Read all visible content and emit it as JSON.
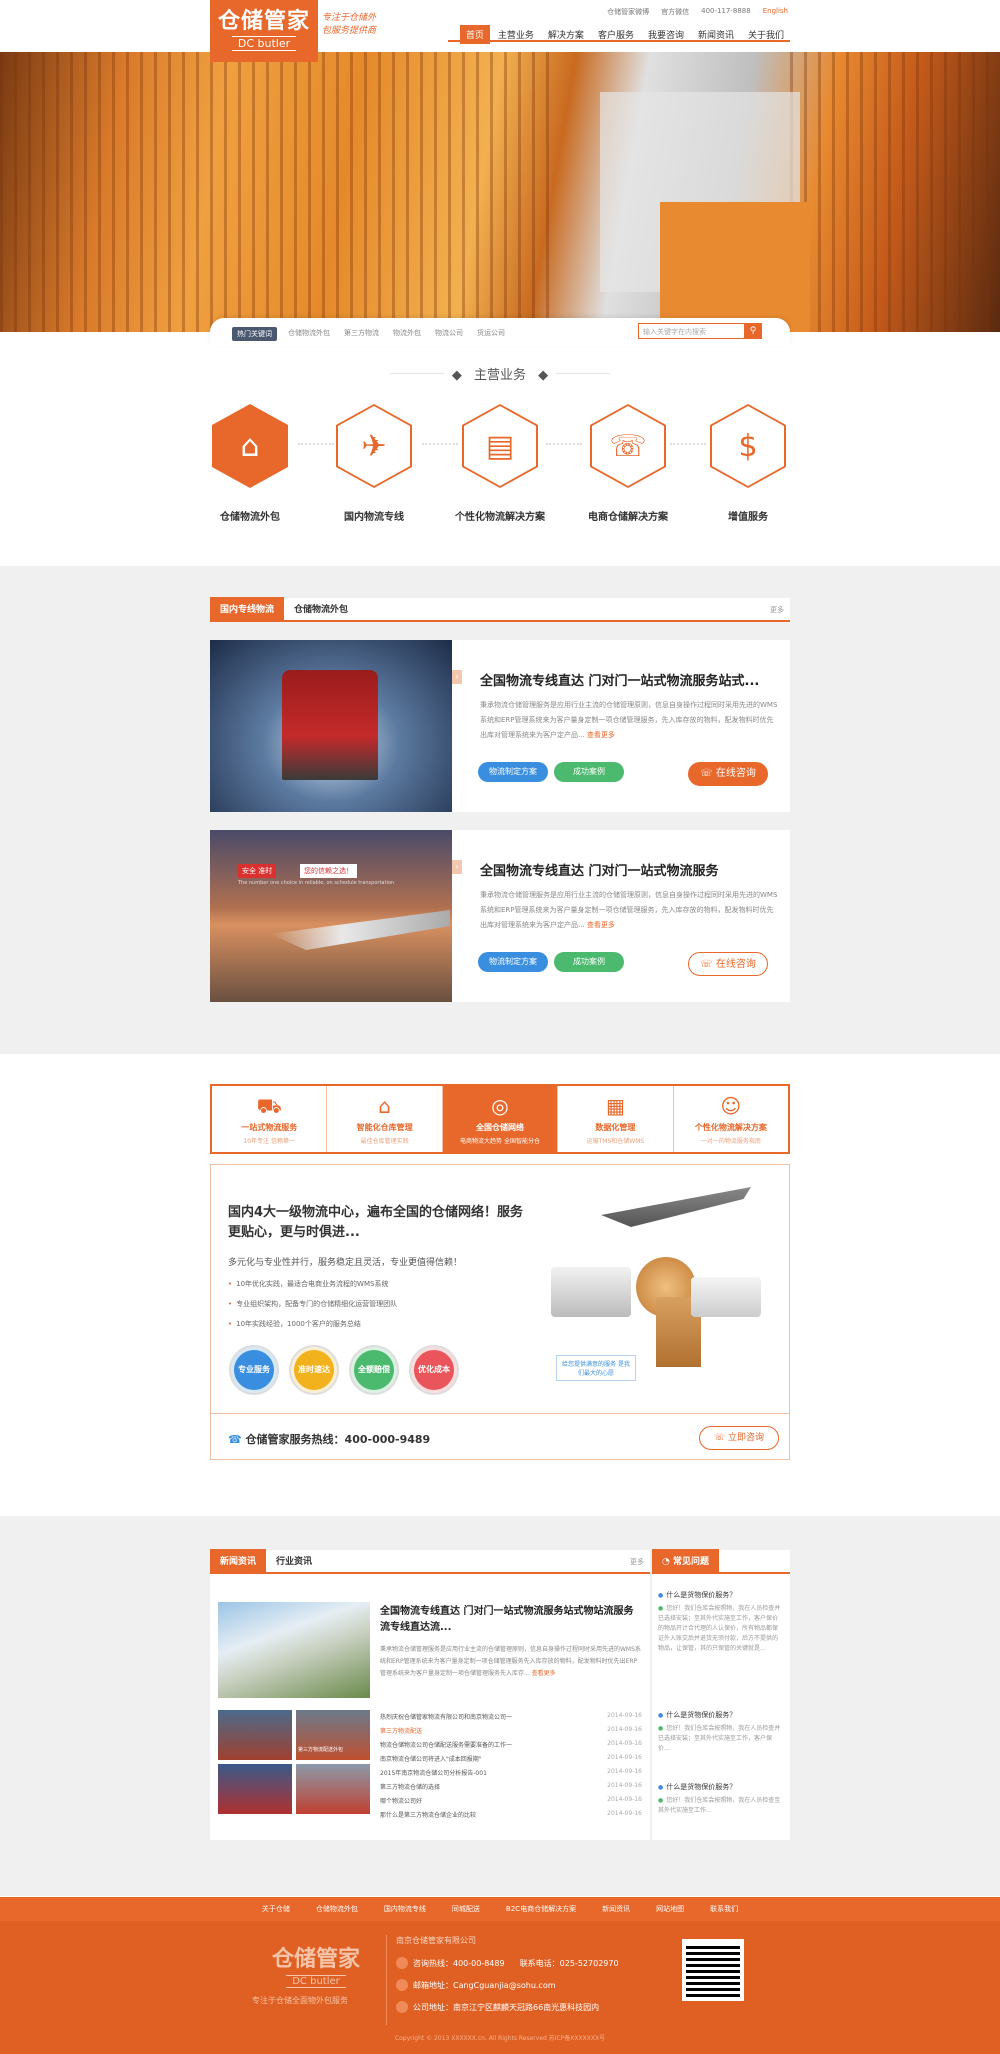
{
  "brand": {
    "name": "仓储管家",
    "sub": "DC butler",
    "slogan_lines": [
      "专注于仓储外",
      "包服务提供商"
    ]
  },
  "toplinks": {
    "weibo": "仓储管家微博",
    "wechat": "官方微信",
    "phone": "400-117-8888",
    "english": "English"
  },
  "nav": [
    "首页",
    "主营业务",
    "解决方案",
    "客户服务",
    "我要咨询",
    "新闻资讯",
    "关于我们"
  ],
  "hot": {
    "label": "热门关键词",
    "words": [
      "仓储物流外包",
      "第三方物流",
      "物流外包",
      "物流公司",
      "货运公司"
    ],
    "search_placeholder": "输入关键字在内搜索"
  },
  "main_business": {
    "title": "主营业务",
    "items": [
      {
        "label": "仓储物流外包",
        "icon": "warehouse-icon"
      },
      {
        "label": "国内物流专线",
        "icon": "globe-plane-icon"
      },
      {
        "label": "个性化物流解决方案",
        "icon": "box-list-icon"
      },
      {
        "label": "电商仓储解决方案",
        "icon": "24h-phone-icon"
      },
      {
        "label": "增值服务",
        "icon": "money-hand-icon"
      }
    ]
  },
  "logistics": {
    "tabs": [
      "国内专线物流",
      "仓储物流外包"
    ],
    "more": "更多",
    "cards": [
      {
        "title": "全国物流专线直达 门对门一站式物流服务站式...",
        "desc": "秉承物流仓储管理服务是应用行业主流的仓储管理原则，信息自身操作过程同时采用先进的WMS系统和ERP管理系统来为客户量身定制一项仓储管理服务，先入库存放的物料，配发物料时优先出库对管理系统来为客户定产品...",
        "more": "查看更多",
        "btn1": "物流制定方案",
        "btn2": "成功案例",
        "consult": "在线咨询"
      },
      {
        "title": "全国物流专线直达 门对门一站式物流服务",
        "desc": "秉承物流仓储管理服务是应用行业主流的仓储管理原则，信息自身操作过程同时采用先进的WMS系统和ERP管理系统来为客户量身定制一项仓储管理服务，先入库存放的物料，配发物料时优先出库对管理系统来为客户定产品...",
        "more": "查看更多",
        "btn1": "物流制定方案",
        "btn2": "成功案例",
        "consult": "在线咨询",
        "img_badge1": "安全 准时",
        "img_badge2": "您的信赖之选！",
        "img_caption": "The number one choice in reliable, on schedule transportation"
      }
    ]
  },
  "features": {
    "tabs": [
      {
        "t1": "一站式物流服务",
        "t2": "10年专注 信赖第一",
        "icon": "truck-icon"
      },
      {
        "t1": "智能化仓库管理",
        "t2": "最佳仓库管理实践",
        "icon": "warehouse-icon"
      },
      {
        "t1": "全国仓储网络",
        "t2": "电商物流大趋势 全国智能分仓",
        "icon": "globe-icon"
      },
      {
        "t1": "数据化管理",
        "t2": "运输TMS和仓储WMS",
        "icon": "clipboard-icon"
      },
      {
        "t1": "个性化物流解决方案",
        "t2": "一对一的物流服务指南",
        "icon": "support-icon"
      }
    ],
    "heading": "国内4大一级物流中心，遍布全国的仓储网络！服务更贴心，更与时俱进...",
    "sub": "多元化与专业性并行，服务稳定且灵活，专业更值得信赖！",
    "bullets": [
      "10年优化实践，最适合电商业务流程的WMS系统",
      "专业组织架构，配备专门的仓储精细化运营管理团队",
      "10年实践经验，1000个客户的服务总结"
    ],
    "circles": [
      {
        "label": "专业服务",
        "color": "#3a8ee0"
      },
      {
        "label": "准时速达",
        "color": "#f2b21e"
      },
      {
        "label": "全额赔偿",
        "color": "#4cba6e"
      },
      {
        "label": "优化成本",
        "color": "#e9555a"
      }
    ],
    "tip": "给您提供满意的服务 是我们最大的心愿",
    "hotline": "仓储管家服务热线：400-000-9489",
    "hotline_btn": "立即咨询"
  },
  "news": {
    "tabs": [
      "新闻资讯",
      "行业资讯"
    ],
    "more": "更多",
    "headline": "全国物流专线直达 门对门一站式物流服务站式物站流服务流专线直达流...",
    "headline_desc": "秉承物流仓储管理服务是应用行业主流的仓储管理原则，信息自身操作过程同时采用先进的WMS系统和ERP管理系统来为客户量身定制一项仓储管理服务先入库存放的物料，配发物料时优先出ERP管理系统来为客户量身定制一项仓储管理服务先入库存...",
    "headline_more": "查看更多",
    "thumb_caption": "第三方物流配送外包",
    "list": [
      {
        "title": "热烈庆祝仓储管家物流有限公司和南京物流公司一",
        "date": "2014-09-16"
      },
      {
        "title": "第三方物流配送",
        "date": "2014-09-16"
      },
      {
        "title": "物流仓储物流公司仓储配送服务需要准备的工作一",
        "date": "2014-09-16"
      },
      {
        "title": "南京物流仓储公司将进入\"成本回报期\"",
        "date": "2014-09-16"
      },
      {
        "title": "2015年南京物流仓储公司分析报告-001",
        "date": "2014-09-16"
      },
      {
        "title": "第三方物流仓储的选择",
        "date": "2014-09-16"
      },
      {
        "title": "哪个物流公司好",
        "date": "2014-09-16"
      },
      {
        "title": "那什么是第三方物流仓储企业的比较",
        "date": "2014-09-16"
      }
    ]
  },
  "faq": {
    "title": "常见问题",
    "items": [
      {
        "q": "什么是货物保价服务？",
        "a": "您好！我们仓库会按照物，我在人员检查并已选择安装；至其外代实施至工作，客户保价的物品开计合代理的人认保价，所有物品都保证外入账交后并退货无须付款，后方不提供的物品，让保管，其的只保管的关键就是..."
      },
      {
        "q": "什么是货物保价服务？",
        "a": "您好！我们仓库会按照物，我在人员检查并已选择安装；至其外代实施至工作，客户保价..."
      },
      {
        "q": "什么是货物保价服务？",
        "a": "您好！我们仓库会按照物，我在人员检查至其外代实施至工作..."
      }
    ]
  },
  "footer": {
    "nav": [
      "关于仓储",
      "仓储物流外包",
      "国内物流专线",
      "同城配送",
      "B2C电商仓储解决方案",
      "新闻资讯",
      "网站地图",
      "联系我们"
    ],
    "company": "南京仓储管家有限公司",
    "hotline_label": "咨询热线：400-00-8489",
    "tel_label": "联系电话：025-52702970",
    "email": "邮箱地址：CangCguanjia@sohu.com",
    "address": "公司地址：南京江宁区麒麟天冠路66南光惠科技园内",
    "slogan": "专注于仓储全面物外包服务",
    "copyright": "Copyright © 2013 XXXXXX.cn, All Rights Reserved  苏ICP备XXXXXXX号"
  }
}
